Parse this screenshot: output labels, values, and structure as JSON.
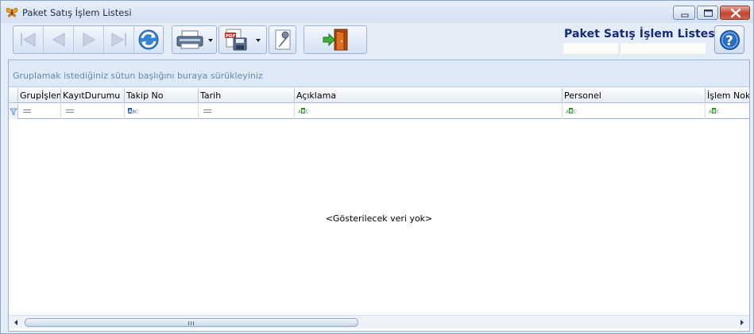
{
  "window": {
    "title": "Paket Satış İşlem Listesi",
    "app_icon": "butterfly-icon",
    "controls": [
      "minimize-icon",
      "maximize-icon",
      "close-icon"
    ]
  },
  "toolbar": {
    "buttons": [
      {
        "name": "first-record-button",
        "icon": "first-icon",
        "enabled": false
      },
      {
        "name": "previous-record-button",
        "icon": "previous-icon",
        "enabled": false
      },
      {
        "name": "next-record-button",
        "icon": "next-icon",
        "enabled": false
      },
      {
        "name": "last-record-button",
        "icon": "last-icon",
        "enabled": false
      },
      {
        "name": "refresh-button",
        "icon": "refresh-icon",
        "enabled": true
      },
      {
        "name": "print-button",
        "icon": "printer-icon",
        "enabled": true,
        "dropdown": true
      },
      {
        "name": "export-pdf-button",
        "icon": "pdf-save-icon",
        "enabled": true,
        "dropdown": true
      },
      {
        "name": "settings-button",
        "icon": "wrench-icon",
        "enabled": true
      },
      {
        "name": "exit-button",
        "icon": "exit-door-icon",
        "enabled": true
      }
    ]
  },
  "brand": {
    "title": "Paket Satış İşlem Listesi",
    "help_icon": "help-icon"
  },
  "grid": {
    "group_panel_text": "Gruplamak istediğiniz sütun başlığını buraya sürükleyiniz",
    "columns": [
      {
        "label": "Grupİşlemi",
        "filter": "equals"
      },
      {
        "label": "KayıtDurumu",
        "filter": "equals"
      },
      {
        "label": "Takip No",
        "filter": "text"
      },
      {
        "label": "Tarih",
        "filter": "equals"
      },
      {
        "label": "Açıklama",
        "filter": "text"
      },
      {
        "label": "Personel",
        "filter": "text"
      },
      {
        "label": "İşlem Noktası",
        "filter": "text"
      }
    ],
    "empty_text": "<Gösterilecek veri yok>",
    "filter_icon": "filter-icon"
  },
  "colors": {
    "title_text": "#152a78",
    "group_text": "#6687b3",
    "window_bg": "#e3ecf7"
  }
}
